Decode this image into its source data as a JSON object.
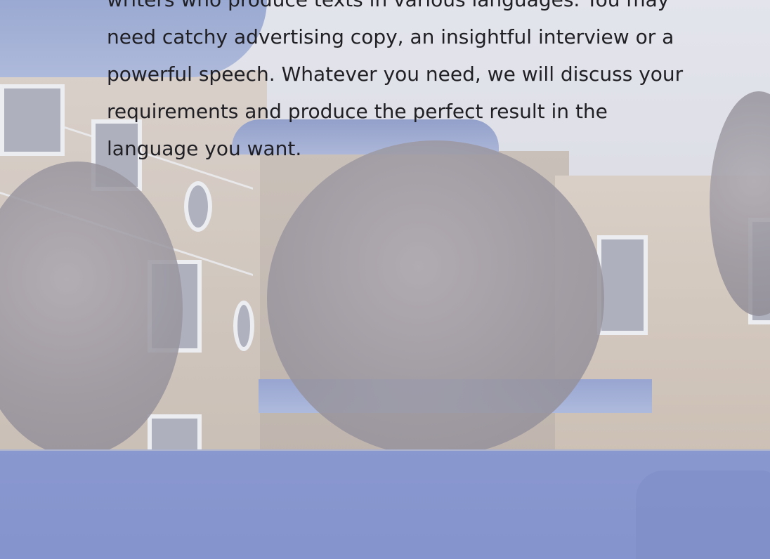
{
  "article": {
    "lines": [
      "writers who produce texts in various languages. You may",
      "need catchy advertising copy, an insightful interview or a",
      "powerful speech. Whatever you need, we will discuss your",
      "requirements and produce the perfect result in the",
      "language you want."
    ]
  },
  "background": {
    "image": "office-building-with-trees-photo",
    "overlay_color": "#7f8fd0"
  }
}
